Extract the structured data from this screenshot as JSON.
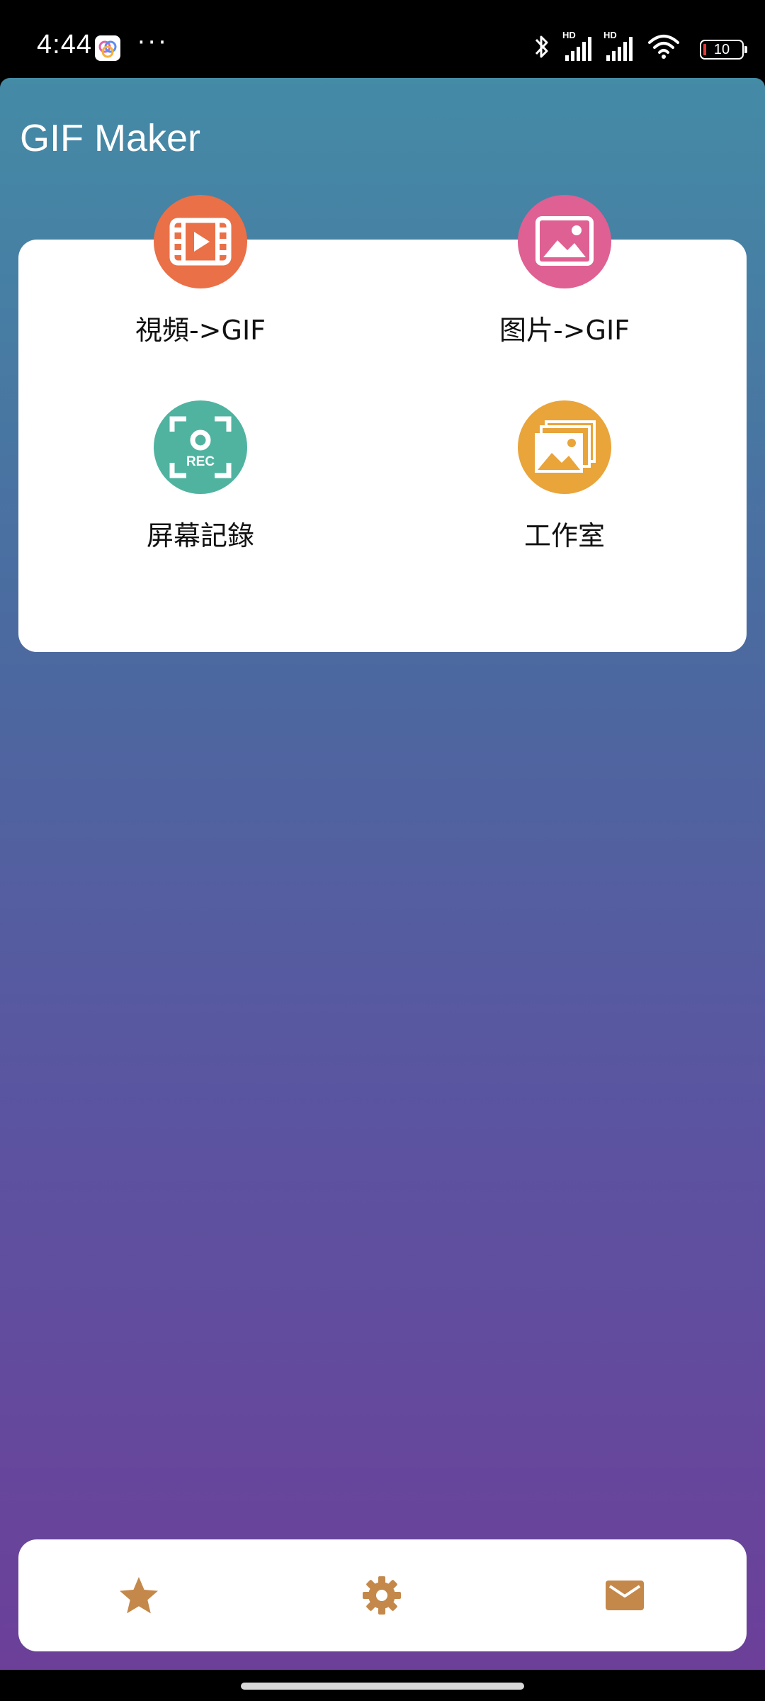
{
  "status_bar": {
    "time": "4:44",
    "overflow_dots": "···",
    "battery_level": "10",
    "network_labels": [
      "HD",
      "HD"
    ]
  },
  "app": {
    "title": "GIF Maker"
  },
  "features": [
    {
      "label": "視頻->GIF",
      "icon": "video-film-icon",
      "color": "#ea7047"
    },
    {
      "label": "图片->GIF",
      "icon": "image-picture-icon",
      "color": "#df6093"
    },
    {
      "label": "屏幕記錄",
      "icon": "screen-record-icon",
      "color": "#4fb3a0"
    },
    {
      "label": "工作室",
      "icon": "gallery-stack-icon",
      "color": "#e9a43a"
    }
  ],
  "bottom_nav": {
    "items": [
      "star-icon",
      "gear-icon",
      "mail-icon"
    ],
    "icon_color": "#c4884a"
  }
}
